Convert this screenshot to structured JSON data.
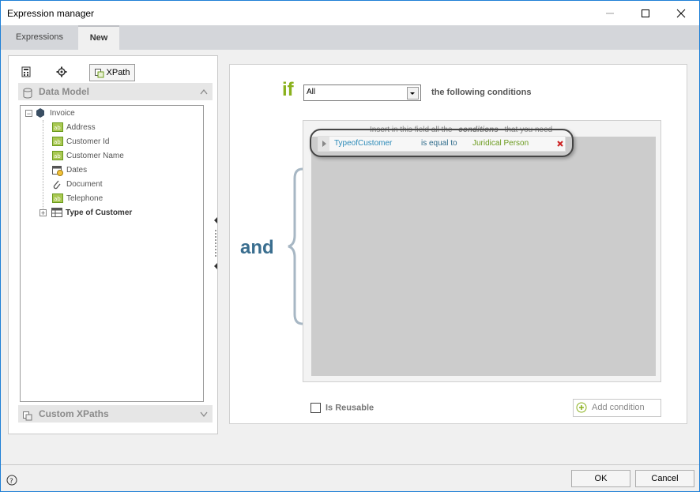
{
  "window": {
    "title": "Expression manager",
    "min_icon": "minimize-icon",
    "max_icon": "maximize-icon",
    "close_icon": "close-icon"
  },
  "tabs": [
    {
      "label": "Expressions"
    },
    {
      "label": "New"
    }
  ],
  "left": {
    "tool_tabs": [
      {
        "icon": "calculator-icon"
      },
      {
        "icon": "gear-icon"
      },
      {
        "label": "XPath",
        "icon": "xpath-icon"
      }
    ],
    "data_model_label": "Data Model",
    "tree": {
      "root": "Invoice",
      "items": [
        {
          "label": "Address",
          "icon": "text-field-icon"
        },
        {
          "label": "Customer Id",
          "icon": "text-field-icon"
        },
        {
          "label": "Customer Name",
          "icon": "text-field-icon"
        },
        {
          "label": "Dates",
          "icon": "calendar-icon"
        },
        {
          "label": "Document",
          "icon": "paperclip-icon"
        },
        {
          "label": "Telephone",
          "icon": "text-field-icon"
        },
        {
          "label": "Type of Customer",
          "icon": "table-icon"
        }
      ]
    },
    "custom_xpaths_label": "Custom XPaths"
  },
  "right": {
    "if_label": "if",
    "quantifier_value": "All",
    "following_text": "the following conditions",
    "and_label": "and",
    "hint_text": "Insert in this field all the",
    "hint_bold": "conditions",
    "hint_tail": "that you need",
    "condition": {
      "field": "TypeofCustomer",
      "operator": "is equal to",
      "value": "Juridical Person"
    },
    "is_reusable_label": "Is Reusable",
    "add_condition_label": "Add condition"
  },
  "footer": {
    "ok_label": "OK",
    "cancel_label": "Cancel",
    "help_icon": "help-icon"
  },
  "colors": {
    "accent_green": "#8ab11d",
    "blue_text": "#3a6e8f",
    "field_blue": "#2b8ab8",
    "value_green": "#6a9a1c",
    "remove_red": "#cc2222"
  }
}
